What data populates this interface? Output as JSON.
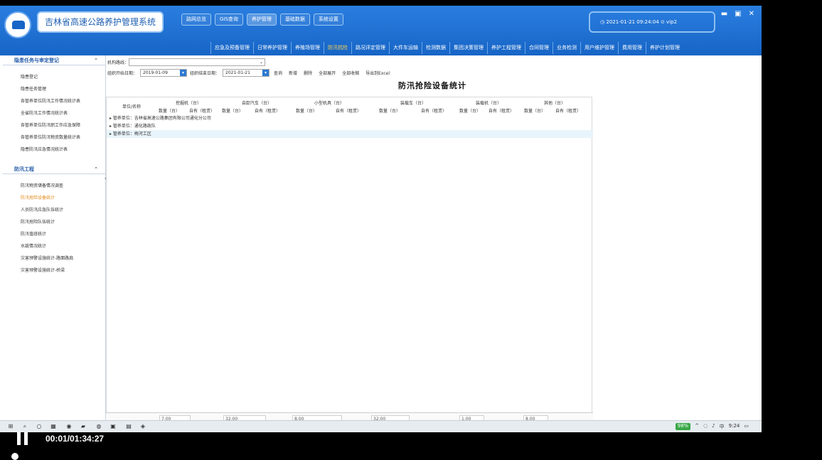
{
  "app": {
    "title": "吉林省高速公路养护管理系统",
    "datetime": "2021-01-21  09:24:04",
    "user": "vip2"
  },
  "topnav": [
    "路网总览",
    "GIS查询",
    "养护管理",
    "基础数据",
    "系统设置"
  ],
  "subnav": [
    "应急及预备管理",
    "日常养护管理",
    "养殖场管理",
    "防汛抗险",
    "路况评定管理",
    "大件车运输",
    "检测数据",
    "集团决策管理",
    "养护工程管理",
    "合同管理",
    "业务检测",
    "用户维护管理",
    "费用管理",
    "养护计划管理"
  ],
  "sidebar": {
    "section1": {
      "title": "隐患任务与审定登记",
      "items": [
        "隐患登记",
        "隐患任务管理",
        "各管养单位防汛工作情况统计表",
        "全省防汛工作情况统计表",
        "各管养单位防汛职工作应急保障",
        "各管养单位防汛物资数量统计表",
        "隐患防汛应急情况统计表"
      ]
    },
    "section2": {
      "title": "防汛工程",
      "items": [
        "防汛物资储备情况调查",
        "防汛抢险设备统计",
        "人员防汛应急队伍统计",
        "防汛抢险队伍统计",
        "防汛值班统计",
        "水毁情况统计",
        "灾害预警设施统计-路面路肩",
        "灾害预警设施统计-桥梁"
      ]
    }
  },
  "filters": {
    "org_label": "机构路线：",
    "org_value": "",
    "start_label": "组织开始日期：",
    "start_value": "2019-01-09",
    "end_label": "组织结束日期：",
    "end_value": "2021-01-21",
    "actions": [
      "查询",
      "新增",
      "删除",
      "全部展开",
      "全部收缩",
      "导出到Excel"
    ]
  },
  "page_title": "防汛抢险设备统计",
  "grid": {
    "row_header": "单位/名称",
    "groups": [
      "挖掘机（台）",
      "自卸汽车（台）",
      "小型机具（台）",
      "装载车（台）",
      "装载机（台）",
      "其他（台）"
    ],
    "sub_headers": [
      "数量（台）",
      "自有（租赁）",
      "数量（台）",
      "自有（租赁）",
      "数量（台）",
      "自有（租赁）",
      "数量（台）",
      "自有（租赁）",
      "数量（台）",
      "自有（租赁）",
      "数量（台）",
      "自有（租赁）"
    ],
    "rows": [
      "▸ 管养单位：吉林省高速公路集团有限公司通化分公司",
      "▸ 管养单位：通化路政队",
      "▸ 管养单位：梅河工区"
    ],
    "footer": [
      "7.00",
      "32.00",
      "8.00",
      "32.00",
      "1.00",
      "8.00"
    ]
  },
  "taskbar": {
    "battery": "98%",
    "lang": "中",
    "time": "9:24"
  },
  "player": {
    "time": "00:01/01:34:27"
  }
}
